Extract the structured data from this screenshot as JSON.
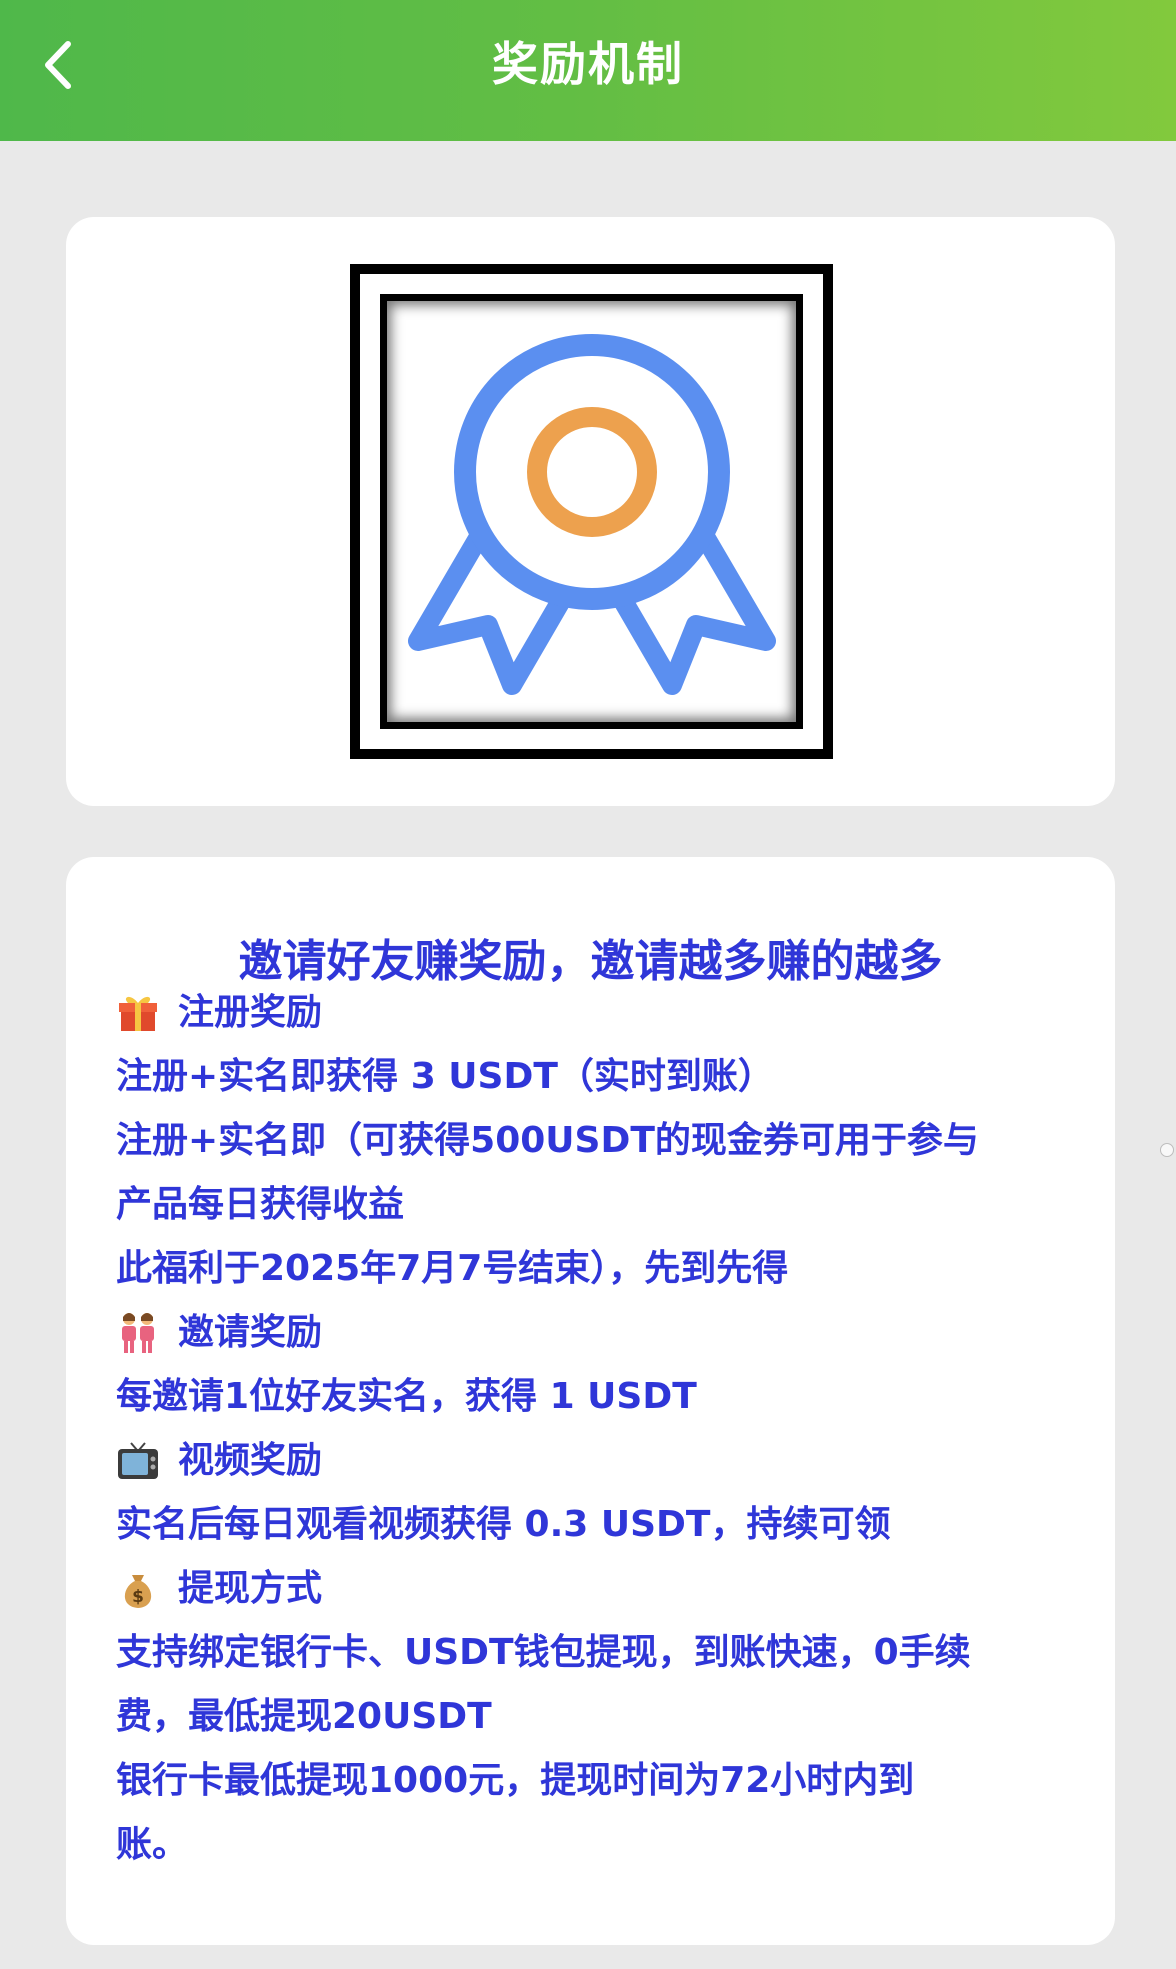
{
  "header": {
    "title": "奖励机制",
    "background_colors": [
      "#4fb84a",
      "#82c93d"
    ]
  },
  "badge": {
    "icon": "award-ribbon-icon",
    "ring_color": "#5b8ff0",
    "center_color": "#eda14e"
  },
  "info": {
    "title": "邀请好友赚奖励，邀请越多赚的越多",
    "text_color": "#2f36d8",
    "register": {
      "icon": "gift-icon",
      "heading": "注册奖励",
      "lines": [
        "注册+实名即获得 3 USDT（实时到账）",
        "注册+实名即（可获得500USDT的现金券可用于参与",
        "产品每日获得收益",
        "此福利于2025年7月7号结束），先到先得"
      ]
    },
    "invite": {
      "icon": "two-people-icon",
      "heading": "邀请奖励",
      "lines": [
        "每邀请1位好友实名，获得 1 USDT"
      ]
    },
    "video": {
      "icon": "tv-icon",
      "heading": "视频奖励",
      "lines": [
        "实名后每日观看视频获得 0.3 USDT，持续可领"
      ]
    },
    "withdraw": {
      "icon": "money-bag-icon",
      "heading": "提现方式",
      "lines": [
        "支持绑定银行卡、USDT钱包提现，到账快速，0手续",
        "费，最低提现20USDT",
        "银行卡最低提现1000元，提现时间为72小时内到",
        "账。"
      ]
    }
  }
}
